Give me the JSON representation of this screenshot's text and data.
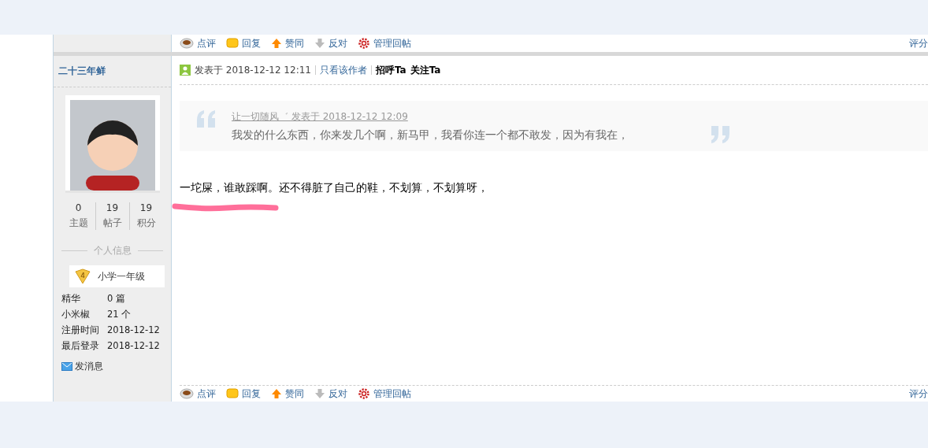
{
  "previous_post": {
    "actions": [
      {
        "kind": "comment",
        "label": "点评"
      },
      {
        "kind": "reply",
        "label": "回复"
      },
      {
        "kind": "support",
        "label": "赞同"
      },
      {
        "kind": "oppose",
        "label": "反对"
      },
      {
        "kind": "manage",
        "label": "管理回帖"
      }
    ],
    "rate_label": "评分"
  },
  "post": {
    "author": {
      "name": "二十三年鲜",
      "stats": [
        {
          "value": "0",
          "label": "主题"
        },
        {
          "value": "19",
          "label": "帖子"
        },
        {
          "value": "19",
          "label": "积分"
        }
      ],
      "section_title": "个人信息",
      "level": {
        "badge": "4",
        "title": "小学一年级"
      },
      "profile": [
        {
          "label": "精华",
          "value": "0 篇"
        },
        {
          "label": "小米椒",
          "value": "21 个"
        },
        {
          "label": "注册时间",
          "value": "2018-12-12"
        },
        {
          "label": "最后登录",
          "value": "2018-12-12"
        }
      ],
      "message_link": "发消息"
    },
    "meta": {
      "posted": "发表于 2018-12-12 12:11",
      "author_only": "只看该作者",
      "greet": "招呼Ta",
      "follow": "关注Ta"
    },
    "quote": {
      "source": "让一切随风゛ 发表于 2018-12-12 12:09",
      "text": "我发的什么东西，你来发几个啊，新马甲，我看你连一个都不敢发，因为有我在，"
    },
    "body": "一坨屎，谁敢踩啊。还不得脏了自己的鞋，不划算，不划算呀，",
    "actions": [
      {
        "kind": "comment",
        "label": "点评"
      },
      {
        "kind": "reply",
        "label": "回复"
      },
      {
        "kind": "support",
        "label": "赞同"
      },
      {
        "kind": "oppose",
        "label": "反对"
      },
      {
        "kind": "manage",
        "label": "管理回帖"
      }
    ],
    "rate_label": "评分"
  }
}
